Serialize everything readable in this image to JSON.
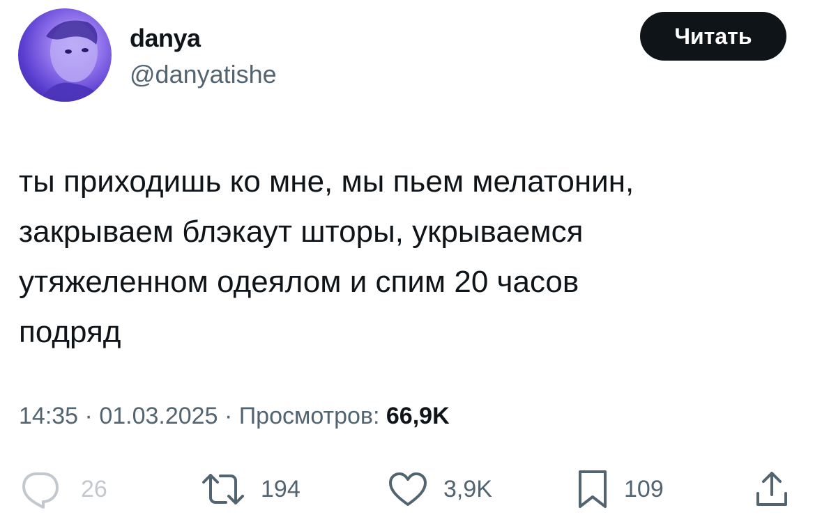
{
  "author": {
    "display_name": "danya",
    "handle": "@danyatishe"
  },
  "follow_button": {
    "label": "Читать"
  },
  "tweet": {
    "text": "ты приходишь ко мне, мы пьем мелатонин,\nзакрываем блэкаут шторы, укрываемся\nутяжеленном одеялом и спим 20 часов\nподряд",
    "time": "14:35",
    "separator": "·",
    "date": "01.03.2025",
    "views_label": "Просмотров:",
    "views_count": "66,9K"
  },
  "actions": {
    "reply": {
      "icon": "reply-icon",
      "count": "26"
    },
    "retweet": {
      "icon": "retweet-icon",
      "count": "194"
    },
    "like": {
      "icon": "heart-icon",
      "count": "3,9K"
    },
    "bookmark": {
      "icon": "bookmark-icon",
      "count": "109"
    },
    "share": {
      "icon": "share-icon"
    }
  },
  "colors": {
    "text_primary": "#0f1419",
    "text_secondary": "#536471",
    "button_bg": "#0f1419",
    "avatar_tint": "#7b5cf0"
  }
}
